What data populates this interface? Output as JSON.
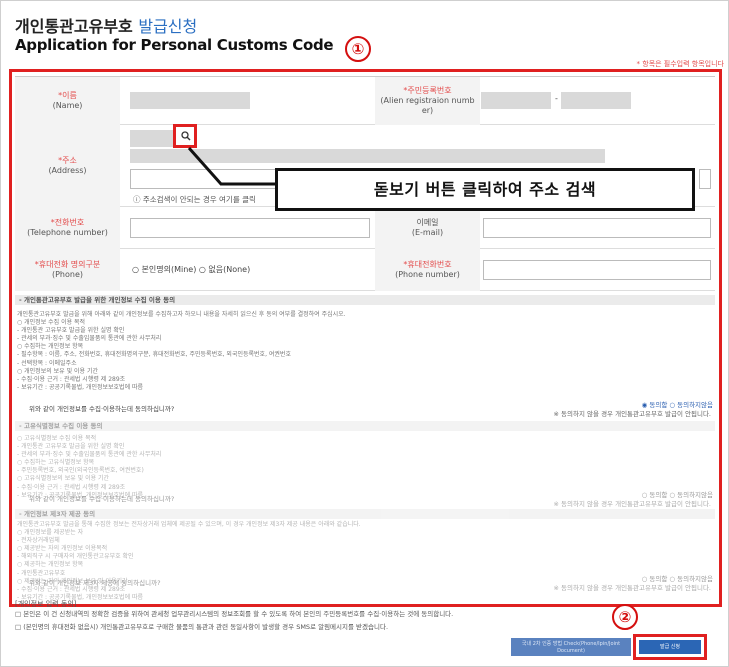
{
  "header": {
    "title_kr": "개인통관고유부호",
    "title_kr_highlight": "발급신청",
    "title_en": "Application for Personal Customs Code",
    "required_note": "* 항목은 필수입력 항목입니다"
  },
  "markers": {
    "one": "①",
    "two": "②"
  },
  "form": {
    "name_label": "*이름",
    "name_label_en": "(Name)",
    "resident_label": "*주민등록번호",
    "resident_label_en": "(Alien registraion numb er)",
    "resident_dash": "-",
    "address_label": "*주소",
    "address_label_en": "(Address)",
    "address_note": "ⓘ 주소검색이 안되는 경우 여기를 클릭",
    "phone_label": "*전화번호",
    "phone_label_en": "(Telephone number)",
    "email_label": "이메일",
    "email_label_en": "(E-mail)",
    "mobile_type_label": "*휴대전화 명의구분",
    "mobile_type_label_en": "(Phone)",
    "mobile_options": "○ 본인명의(Mine) ○ 없음(None)",
    "mobile_label": "*휴대전화번호",
    "mobile_label_en": "(Phone number)"
  },
  "callout": {
    "text": "돋보기 버튼 클릭하여 주소 검색"
  },
  "agreement": {
    "sec1_title": "- 개인통관고유부호 발급을 위한 개인정보 수집 이용 동의",
    "sec1_body": "개인통관고유부호 발급을 위해 아래와 같이 개인정보를 수집하고자 하오니 내용을 자세히 읽으신 후 동의 여부를 결정하여 주십시오.\n○ 개인정보 수집 이용 목적\n - 개인통관 고유부호 발급을 위한 실명 확인\n - 관세의 부과·징수 및 수출입물품의 통관에 관한 사무처리\n○ 수집하는 개인정보 항목\n - 필수항목 : 이름, 주소, 전화번호, 휴대전화명의구분, 휴대전화번호, 주민등록번호, 외국인등록번호, 여권번호\n - 선택항목 : 이메일주소\n○ 개인정보의 보유 및 이용 기간\n - 수집·이용 근거 : 관세법 시행령 제 289조\n - 보유기간 : 공공기록물법, 개인정보보호법에 따름",
    "sec1_question": "위와 같이 개인정보를 수집·이용하는데 동의하십니까?",
    "sec1_options": "◉ 동의함 ○ 동의하지않음",
    "sec1_warning": "※ 동의하지 않을 경우 개인통관고유부호 발급이 안됩니다.",
    "sec2_title": "- 고유식별정보 수집 이용 동의",
    "sec2_body": "○ 고유식별정보 수집 이용 목적\n - 개인통관 고유부호 발급을 위한 실명 확인\n - 관세의 부과·징수 및 수출입물품의 통관에 관한 사무처리\n○ 수집하는 고유식별정보 항목\n - 주민등록번호, 외국인(외국인등록번호, 여권번호)\n○ 고유식별정보의 보유 및 이용 기간\n - 수집·이용 근거 : 관세법 시행령 제 289조\n - 보유기간 : 공공기록물법, 개인정보보호법에 따름",
    "sec2_question": "위와 같이 개인정보를 수집·이용하는데 동의하십니까?",
    "sec2_options": "○ 동의함 ○ 동의하지않음",
    "sec2_warning": "※ 동의하지 않을 경우 개인통관고유부호 발급이 안됩니다.",
    "sec3_title": "- 개인정보 제3자 제공 동의",
    "sec3_body": "개인통관고유부호 발급을 통해 수집한 정보는 전자상거래 업체에 제공될 수 있으며, 이 경우 개인정보 제3자 제공 내용은 아래와 같습니다.\n○ 개인정보를 제공받는 자\n - 전자상거래업체\n○ 제공받는 자의 개인정보 이용목적\n - 해외직구 시 구매자의 개인통관고유부호 확인\n○ 제공하는 개인정보 항목\n - 개인통관고유부호\n○ 제공받는 자의 개인정보 보유 및 이용기간\n - 수집·이용 근거 : 관세법 시행령 제 289조\n - 보유기간 : 공공기록물법, 개인정보보호법에 따름",
    "sec3_question": "위와 같이 개인정보 제3자 제공에 동의하십니까?",
    "sec3_options": "○ 동의함 ○ 동의하지않음",
    "sec3_warning": "※ 동의하지 않을 경우 개인통관고유부호 발급이 안됩니다."
  },
  "bottom": {
    "notice_title": "[개인정보 입력 동의]",
    "notice_line1": "□ 본인은 이 건 신청내역의 정확한 검증을 위하여 관세청 업무관리시스템의 정보조회를 할 수 있도록 하여 본인의 주민등록번호를 수집·이용하는 것에 동의합니다.",
    "notice_line2": "□ (본인명의 휴대전화 없음시) 개인통관고유부호로 구매한 물품의 통관과 관련 동일사항이 발생할 경우 SMS로 알림메시지를 받겠습니다.",
    "btn_verify": "국내 2차 인증 방법 Check(Phone/Ipin/Joint Document)",
    "btn_submit": "발급 신청"
  }
}
